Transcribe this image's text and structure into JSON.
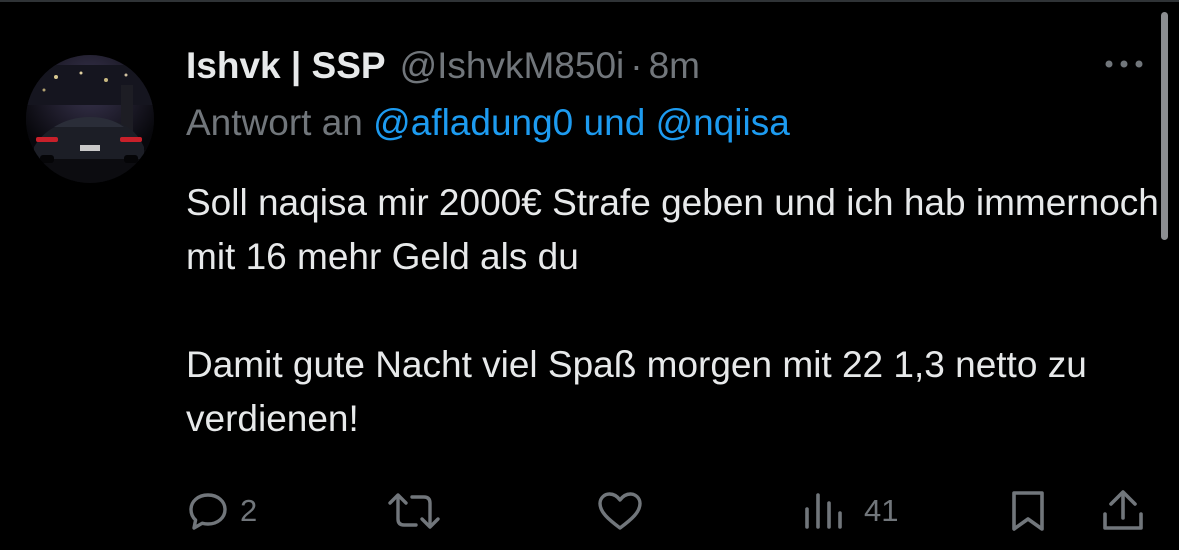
{
  "tweet": {
    "author": {
      "display_name": "Ishvk | SSP",
      "handle": "@IshvkM850i",
      "separator": "·",
      "time_ago": "8m",
      "avatar_icon": "avatar-car-night-photo"
    },
    "reply_to": {
      "prefix": "Antwort an ",
      "mention_1": "@afladung0",
      "connector": " und ",
      "mention_2": "@nqiisa"
    },
    "text": "Soll naqisa mir 2000€ Strafe geben und ich hab immernoch mit 16 mehr Geld als du\n\nDamit gute Nacht viel Spaß morgen mit 22 1,3 netto zu verdienen!",
    "actions": {
      "reply_count": "2",
      "retweet_count": "",
      "like_count": "",
      "view_count": "41"
    }
  },
  "theme": {
    "background": "#000000",
    "text": "#e7e9ea",
    "muted": "#71767b",
    "mention": "#1d9bf0"
  },
  "icons": [
    "more-icon",
    "reply-icon",
    "retweet-icon",
    "like-icon",
    "views-icon",
    "bookmark-icon",
    "share-icon"
  ]
}
